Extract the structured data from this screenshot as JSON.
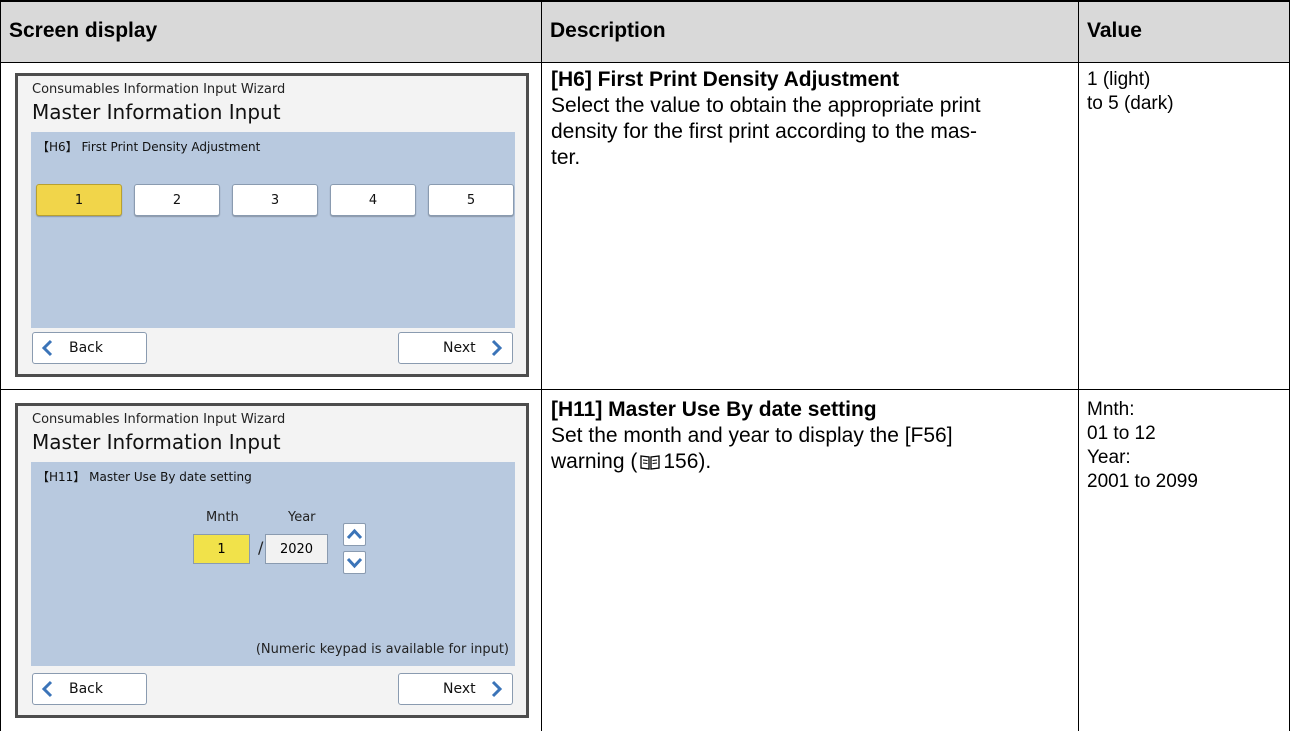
{
  "table": {
    "headers": [
      "Screen display",
      "Description",
      "Value"
    ],
    "rows": [
      {
        "screen": {
          "wizard_label": "Consumables Information Input Wizard",
          "title": "Master Information Input",
          "setting_label": "【H6】 First Print Density Adjustment",
          "options": [
            "1",
            "2",
            "3",
            "4",
            "5"
          ],
          "selected_option": "1",
          "back_label": "Back",
          "next_label": "Next"
        },
        "description_title": "[H6] First Print Density Adjustment",
        "description_lines": [
          "Select the value to obtain the appropriate print",
          "density for the first print according to the mas-",
          "ter."
        ],
        "value": "1 (light)\nto 5 (dark)"
      },
      {
        "screen": {
          "wizard_label": "Consumables Information Input Wizard",
          "title": "Master Information Input",
          "setting_label": "【H11】 Master Use By date setting",
          "month_label": "Mnth",
          "year_label": "Year",
          "month_value": "1",
          "separator": "/",
          "year_value": "2020",
          "keypad_note": "(Numeric keypad is available for input)",
          "back_label": "Back",
          "next_label": "Next"
        },
        "description_title": "[H11] Master Use By date setting",
        "description_lines": [
          "Set the month and year to display the [F56]",
          "warning (",
          "156)."
        ],
        "book_icon": "book-reference-icon",
        "value": "Mnth:\n01 to 12\nYear:\n2001 to 2099"
      }
    ]
  },
  "colors": {
    "header_bg": "#d9d9d9",
    "panel_bg": "#b8c9df",
    "selected_bg": "#f1d54a",
    "chevron": "#3b74b8"
  }
}
